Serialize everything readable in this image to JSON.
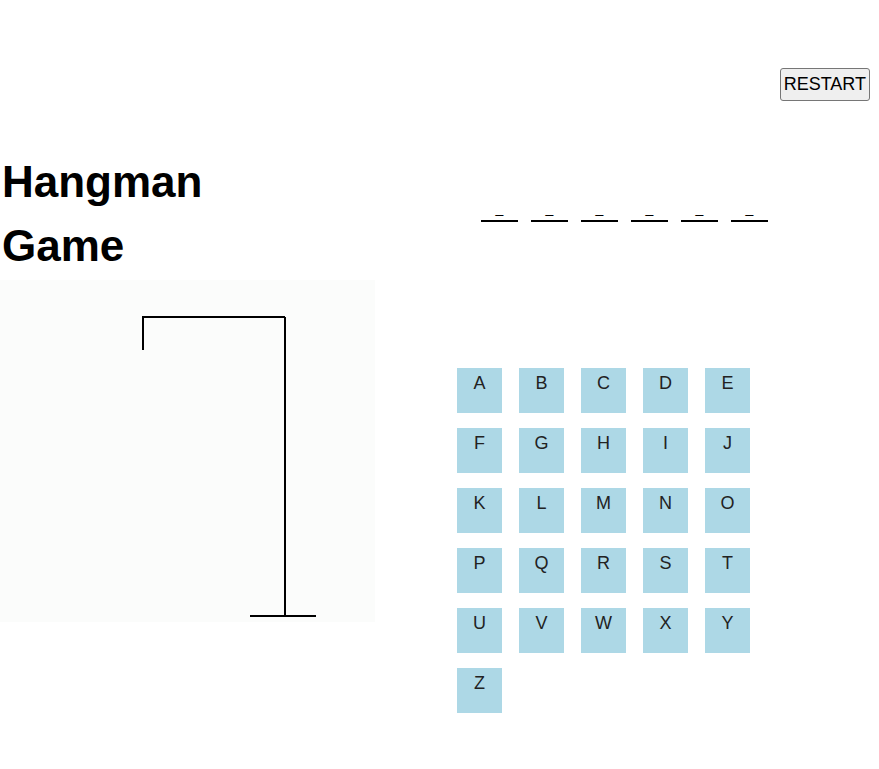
{
  "title": "Hangman Game",
  "restart_button": "RESTART",
  "word": [
    "_",
    "_",
    "_",
    "_",
    "_",
    "_"
  ],
  "hangman": {
    "wrong_guesses": 0
  },
  "letters": [
    "A",
    "B",
    "C",
    "D",
    "E",
    "F",
    "G",
    "H",
    "I",
    "J",
    "K",
    "L",
    "M",
    "N",
    "O",
    "P",
    "Q",
    "R",
    "S",
    "T",
    "U",
    "V",
    "W",
    "X",
    "Y",
    "Z"
  ]
}
